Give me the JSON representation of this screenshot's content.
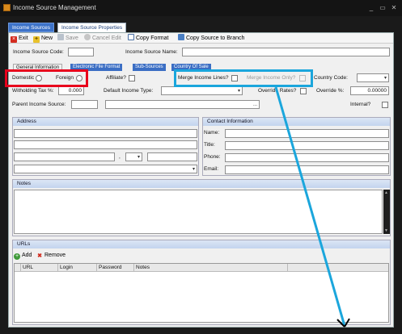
{
  "window": {
    "title": "Income Source Management",
    "minimize": "_",
    "maximize": "▭",
    "close": "✕"
  },
  "tabs": [
    {
      "label": "Income Sources"
    },
    {
      "label": "Income Source Properties"
    }
  ],
  "toolbar": {
    "exit": "Exit",
    "new": "New",
    "save": "Save",
    "cancel_edit": "Cancel Edit",
    "copy_format": "Copy Format",
    "copy_source": "Copy Source to Branch"
  },
  "form": {
    "code_label": "Income Source Code:",
    "code_value": "",
    "name_label": "Income Source Name:",
    "name_value": ""
  },
  "subtabs": [
    {
      "label": "General Information"
    },
    {
      "label": "Electronic File Format"
    },
    {
      "label": "Sub-Sources"
    },
    {
      "label": "Country Of Sale"
    }
  ],
  "general": {
    "domestic_label": "Domestic",
    "foreign_label": "Foreign",
    "affiliate_label": "Affiliate?",
    "merge_lines_label": "Merge Income Lines?",
    "merge_only_label": "Merge Income Only?",
    "country_code_label": "Country Code:",
    "withholding_label": "Witholding Tax %:",
    "withholding_value": "0.000",
    "default_type_label": "Default Income Type:",
    "override_rates_label": "Override Rates?",
    "override_pct_label": "Override %:",
    "override_pct_value": "0.00000",
    "parent_label": "Parent Income Source:",
    "ellipsis": "...",
    "internal_label": "Internal?"
  },
  "address": {
    "heading": "Address",
    "separator": ","
  },
  "contact": {
    "heading": "Contact Information",
    "name_label": "Name:",
    "title_label": "Title:",
    "phone_label": "Phone:",
    "email_label": "Email:"
  },
  "notes": {
    "heading": "Notes"
  },
  "urls": {
    "heading": "URLs",
    "add_label": "Add",
    "remove_label": "Remove",
    "columns": [
      "URL",
      "Login",
      "Password",
      "Notes"
    ]
  },
  "colors": {
    "highlight_red": "#e8001c",
    "highlight_blue": "#1ba6dc",
    "tab_blue": "#3d73c9"
  }
}
